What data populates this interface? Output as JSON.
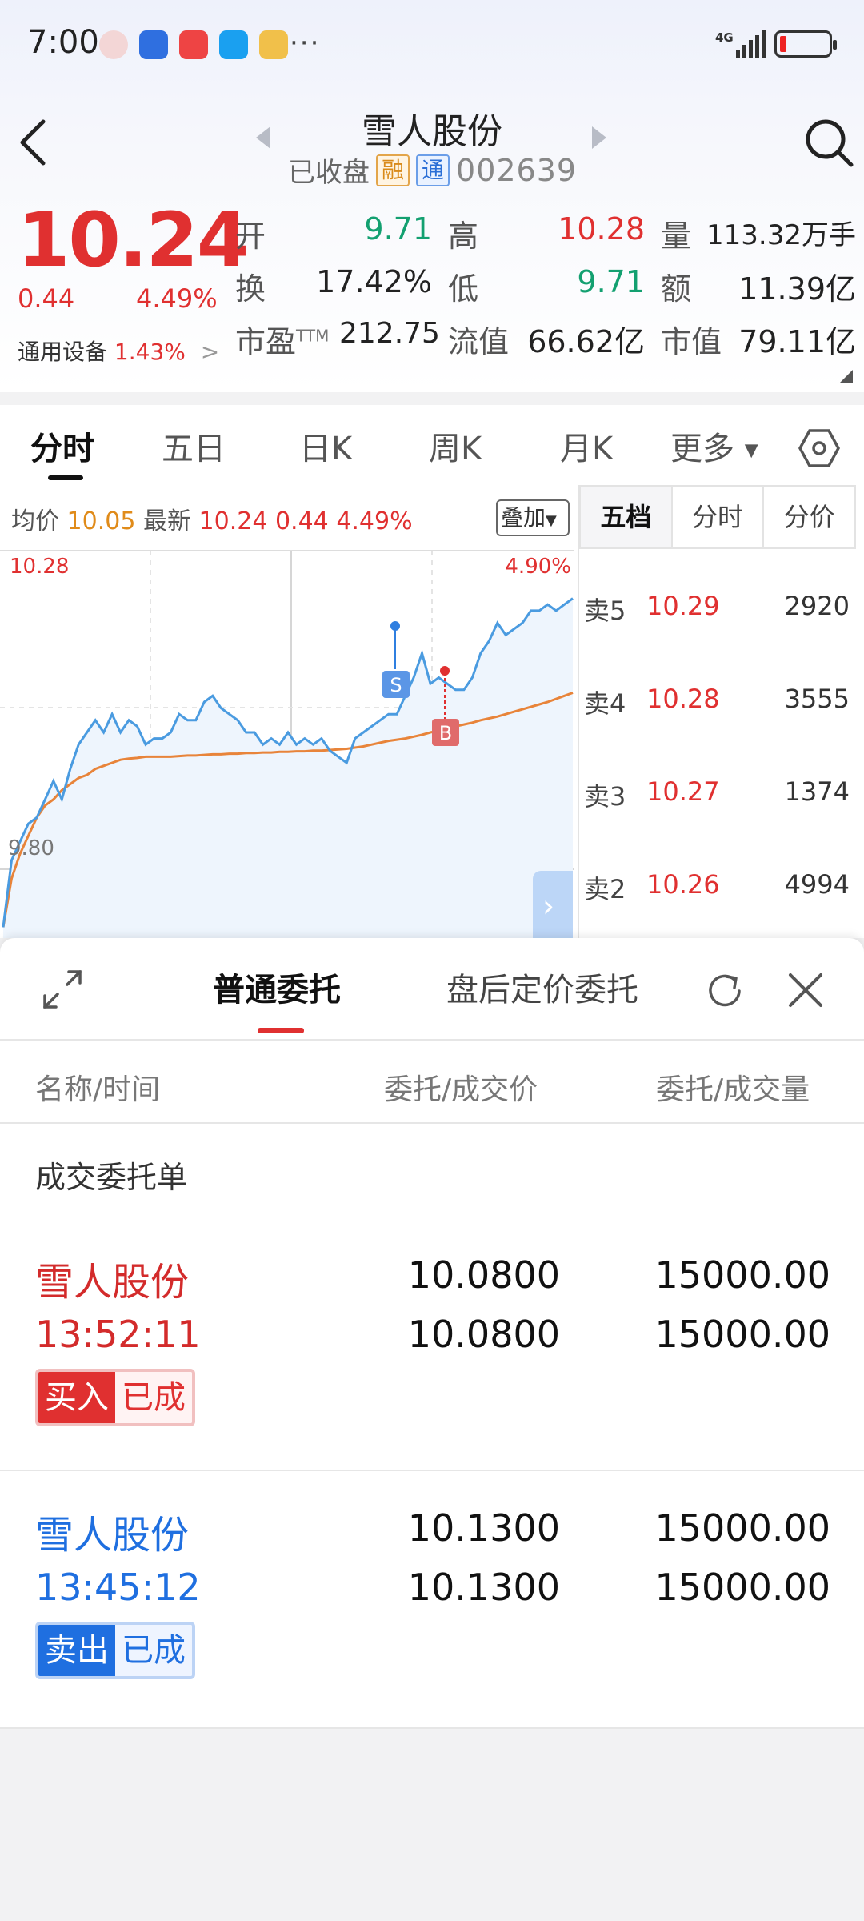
{
  "status_bar": {
    "time": "7:00",
    "more": "···",
    "network": "4G"
  },
  "header": {
    "stock_name": "雪人股份",
    "market_status": "已收盘",
    "tag_rong": "融",
    "tag_tong": "通",
    "stock_code": "002639"
  },
  "quote": {
    "price": "10.24",
    "change": "0.44",
    "change_pct": "4.49%",
    "sector_name": "通用设备",
    "sector_pct": "1.43%",
    "sector_chevron": ">",
    "open_label": "开",
    "open": "9.71",
    "high_label": "高",
    "high": "10.28",
    "volume_label": "量",
    "volume": "113.32万手",
    "turnover_label": "换",
    "turnover": "17.42%",
    "low_label": "低",
    "low": "9.71",
    "amount_label": "额",
    "amount": "11.39亿",
    "pe_label": "市盈",
    "pe_sup": "TTM",
    "pe": "212.75",
    "float_cap_label": "流值",
    "float_cap": "66.62亿",
    "mkt_cap_label": "市值",
    "mkt_cap": "79.11亿"
  },
  "tabs": [
    "分时",
    "五日",
    "日K",
    "周K",
    "月K",
    "更多"
  ],
  "chart_info": {
    "avg_label": "均价",
    "avg": "10.05",
    "last_label": "最新",
    "last": "10.24",
    "change": "0.44",
    "change_pct": "4.49%",
    "overlay_label": "叠加"
  },
  "chart_data": {
    "type": "line",
    "high_label": "10.28",
    "low_label": "9.80",
    "pct_label": "4.90%",
    "ylim": [
      9.71,
      10.32
    ],
    "marker_s": "S",
    "marker_b": "B",
    "series": [
      {
        "values": [
          9.72,
          9.83,
          9.86,
          9.89,
          9.9,
          9.93,
          9.96,
          9.93,
          9.98,
          10.02,
          10.04,
          10.06,
          10.04,
          10.07,
          10.04,
          10.06,
          10.05,
          10.02,
          10.03,
          10.03,
          10.04,
          10.07,
          10.06,
          10.06,
          10.09,
          10.1,
          10.08,
          10.07,
          10.06,
          10.04,
          10.04,
          10.02,
          10.03,
          10.02,
          10.04,
          10.02,
          10.03,
          10.02,
          10.03,
          10.01,
          10.0,
          9.99,
          10.03,
          10.04,
          10.05,
          10.06,
          10.07,
          10.07,
          10.1,
          10.13,
          10.17,
          10.12,
          10.13,
          10.12,
          10.11,
          10.11,
          10.13,
          10.17,
          10.19,
          10.22,
          10.2,
          10.21,
          10.22,
          10.24,
          10.24,
          10.25,
          10.24,
          10.25,
          10.26
        ]
      },
      {
        "values": [
          9.72,
          9.8,
          9.84,
          9.87,
          9.9,
          9.92,
          9.93,
          9.945,
          9.955,
          9.965,
          9.97,
          9.98,
          9.985,
          9.99,
          9.995,
          9.997,
          9.998,
          10.0,
          10.0,
          10.0,
          10.0,
          10.001,
          10.002,
          10.002,
          10.003,
          10.004,
          10.004,
          10.005,
          10.005,
          10.006,
          10.006,
          10.007,
          10.007,
          10.008,
          10.008,
          10.009,
          10.009,
          10.01,
          10.01,
          10.011,
          10.012,
          10.013,
          10.015,
          10.017,
          10.02,
          10.023,
          10.026,
          10.028,
          10.03,
          10.033,
          10.036,
          10.04,
          10.043,
          10.046,
          10.05,
          10.053,
          10.056,
          10.06,
          10.063,
          10.066,
          10.07,
          10.074,
          10.078,
          10.082,
          10.086,
          10.09,
          10.095,
          10.1,
          10.105
        ]
      }
    ]
  },
  "order_book": {
    "tabs": [
      "五档",
      "分时",
      "分价"
    ],
    "rows": [
      {
        "label": "卖5",
        "price": "10.29",
        "volume": "2920"
      },
      {
        "label": "卖4",
        "price": "10.28",
        "volume": "3555"
      },
      {
        "label": "卖3",
        "price": "10.27",
        "volume": "1374"
      },
      {
        "label": "卖2",
        "price": "10.26",
        "volume": "4994"
      }
    ]
  },
  "sheet": {
    "tab_normal": "普通委托",
    "tab_after": "盘后定价委托",
    "col_name": "名称/时间",
    "col_price": "委托/成交价",
    "col_qty": "委托/成交量",
    "section_title": "成交委托单",
    "orders": [
      {
        "name": "雪人股份",
        "time": "13:52:11",
        "order_price": "10.0800",
        "deal_price": "10.0800",
        "order_qty": "15000.00",
        "deal_qty": "15000.00",
        "side": "买入",
        "status": "已成"
      },
      {
        "name": "雪人股份",
        "time": "13:45:12",
        "order_price": "10.1300",
        "deal_price": "10.1300",
        "order_qty": "15000.00",
        "deal_qty": "15000.00",
        "side": "卖出",
        "status": "已成"
      }
    ]
  },
  "colors": {
    "up": "#e03030",
    "down": "#13a070",
    "price_line": "#4a9be0",
    "avg_line": "#e8843a",
    "sell": "#1f6fe0"
  }
}
